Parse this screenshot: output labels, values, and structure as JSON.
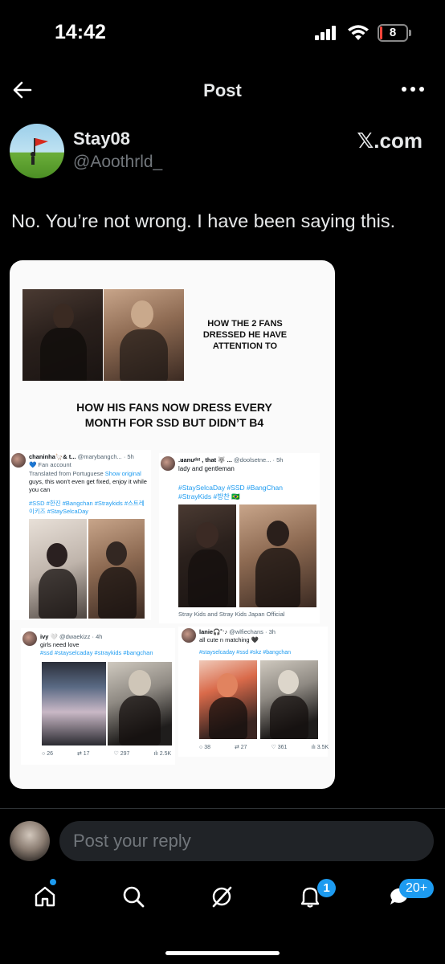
{
  "status_bar": {
    "time": "14:42",
    "battery": "8",
    "battery_level": 0.08
  },
  "header": {
    "title": "Post"
  },
  "author": {
    "name": "Stay08",
    "handle": "@Aoothrld_",
    "brand": "𝕏.com"
  },
  "post": {
    "text": "No. You’re not wrong. I have been saying this."
  },
  "media": {
    "caption_top": "HOW THE 2 FANS DRESSED HE HAVE ATTENTION TO",
    "caption_mid": "HOW HIS FANS NOW DRESS EVERY MONTH FOR SSD BUT DIDN’T B4",
    "tweets": [
      {
        "name": "chaninha🦙& t...",
        "handle": "@marybangch...",
        "time": "· 5h",
        "badge": "💙 Fan account",
        "translated": "Translated from Portuguese",
        "show_original": "Show original",
        "text": "guys, this won't even get fixed, enjoy it while you can",
        "tags": "#SSD #한진 #Bangchan #Straykids #스트레이키즈 #StaySelcaDay"
      },
      {
        "name": ".ᴚanuᵈˢᵗ , that 🐺 ...",
        "handle": "@doolsetne...",
        "time": "· 5h",
        "text": "lady and gentleman",
        "tags": "#StaySelcaDay #SSD #BangChan #StrayKids #방찬 🇧🇷",
        "footer": "Stray Kids and Stray Kids Japan Official"
      },
      {
        "name": "ivy 🤍",
        "handle": "@dwaekizz",
        "time": "· 4h",
        "text": "girls need love",
        "tags": "#ssd #stayselcaday #straykids #bangchan",
        "stats": {
          "replies": "26",
          "reposts": "17",
          "likes": "297",
          "views": "2.5K"
        }
      },
      {
        "name": "lanie🎧˚ˑ♪",
        "handle": "@wlfiechans",
        "time": "· 3h",
        "text": "all cute n matching 🖤",
        "tags": "#stayselcaday #ssd #skz #bangchan",
        "stats": {
          "replies": "38",
          "reposts": "27",
          "likes": "361",
          "views": "3.5K"
        }
      }
    ]
  },
  "reply": {
    "placeholder": "Post your reply"
  },
  "tabbar": {
    "items": [
      "home-icon",
      "search-icon",
      "grok-icon",
      "bell-icon",
      "messages-icon"
    ],
    "notifications_badge": "1",
    "messages_badge": "20+"
  },
  "colors": {
    "background": "#000000",
    "accent": "#1d9bf0",
    "text": "#e7e9ea",
    "muted": "#71767b",
    "input_bg": "#202327"
  }
}
